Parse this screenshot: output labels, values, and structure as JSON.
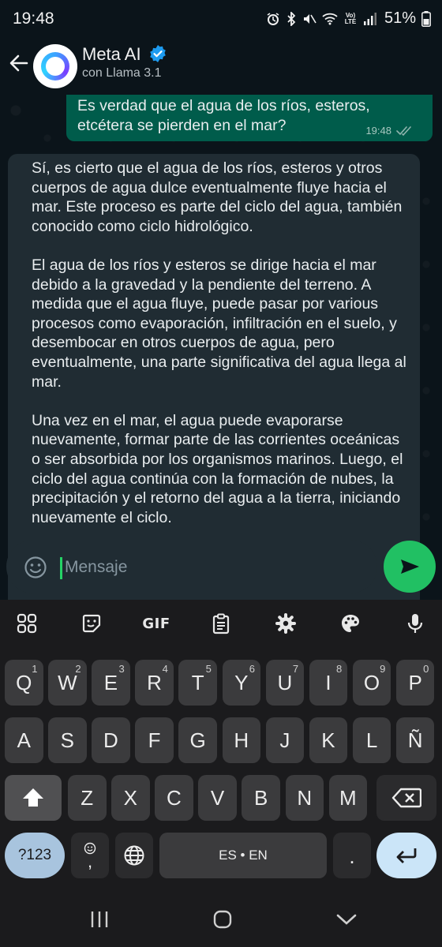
{
  "status_bar": {
    "time": "19:48",
    "network_label": "Vo) LTE",
    "battery_percent": "51%"
  },
  "header": {
    "contact_name": "Meta AI",
    "contact_subtitle": "con Llama 3.1"
  },
  "messages": {
    "outgoing": {
      "text": "Es verdad que el agua de los ríos, esteros, etcétera se pierden en el mar?",
      "time": "19:48"
    },
    "incoming": {
      "paragraphs": [
        "Sí, es cierto que el agua de los ríos, esteros y otros cuerpos de agua dulce eventualmente fluye hacia el mar. Este proceso es parte del ciclo del agua, también conocido como ciclo hidrológico.",
        "El agua de los ríos y esteros se dirige hacia el mar debido a la gravedad y la pendiente del terreno. A medida que el agua fluye, puede pasar por various procesos como evaporación, infiltración en el suelo, y desembocar en otros cuerpos de agua, pero eventualmente, una parte significativa del agua llega al mar.",
        "Una vez en el mar, el agua puede evaporarse nuevamente, formar parte de las corrientes oceánicas o ser absorbida por los organismos marinos. Luego, el ciclo del agua continúa con la formación de nubes, la precipitación y el retorno del agua a la tierra, iniciando nuevamente el ciclo."
      ]
    }
  },
  "composer": {
    "placeholder": "Mensaje"
  },
  "keyboard": {
    "toolbar_gif": "GIF",
    "rows": [
      [
        {
          "k": "Q",
          "s": "1"
        },
        {
          "k": "W",
          "s": "2"
        },
        {
          "k": "E",
          "s": "3"
        },
        {
          "k": "R",
          "s": "4"
        },
        {
          "k": "T",
          "s": "5"
        },
        {
          "k": "Y",
          "s": "6"
        },
        {
          "k": "U",
          "s": "7"
        },
        {
          "k": "I",
          "s": "8"
        },
        {
          "k": "O",
          "s": "9"
        },
        {
          "k": "P",
          "s": "0"
        }
      ],
      [
        {
          "k": "A"
        },
        {
          "k": "S"
        },
        {
          "k": "D"
        },
        {
          "k": "F"
        },
        {
          "k": "G"
        },
        {
          "k": "H"
        },
        {
          "k": "J"
        },
        {
          "k": "K"
        },
        {
          "k": "L"
        },
        {
          "k": "Ñ"
        }
      ],
      [
        {
          "k": "Z"
        },
        {
          "k": "X"
        },
        {
          "k": "C"
        },
        {
          "k": "V"
        },
        {
          "k": "B"
        },
        {
          "k": "N"
        },
        {
          "k": "M"
        }
      ]
    ],
    "symbols_label": "?123",
    "comma_label": ",",
    "space_label": "ES • EN",
    "period_label": "."
  },
  "colors": {
    "outgoing_bubble": "#005c4b",
    "incoming_bubble": "#202c33",
    "send_button": "#21c063",
    "background": "#0b141a"
  }
}
